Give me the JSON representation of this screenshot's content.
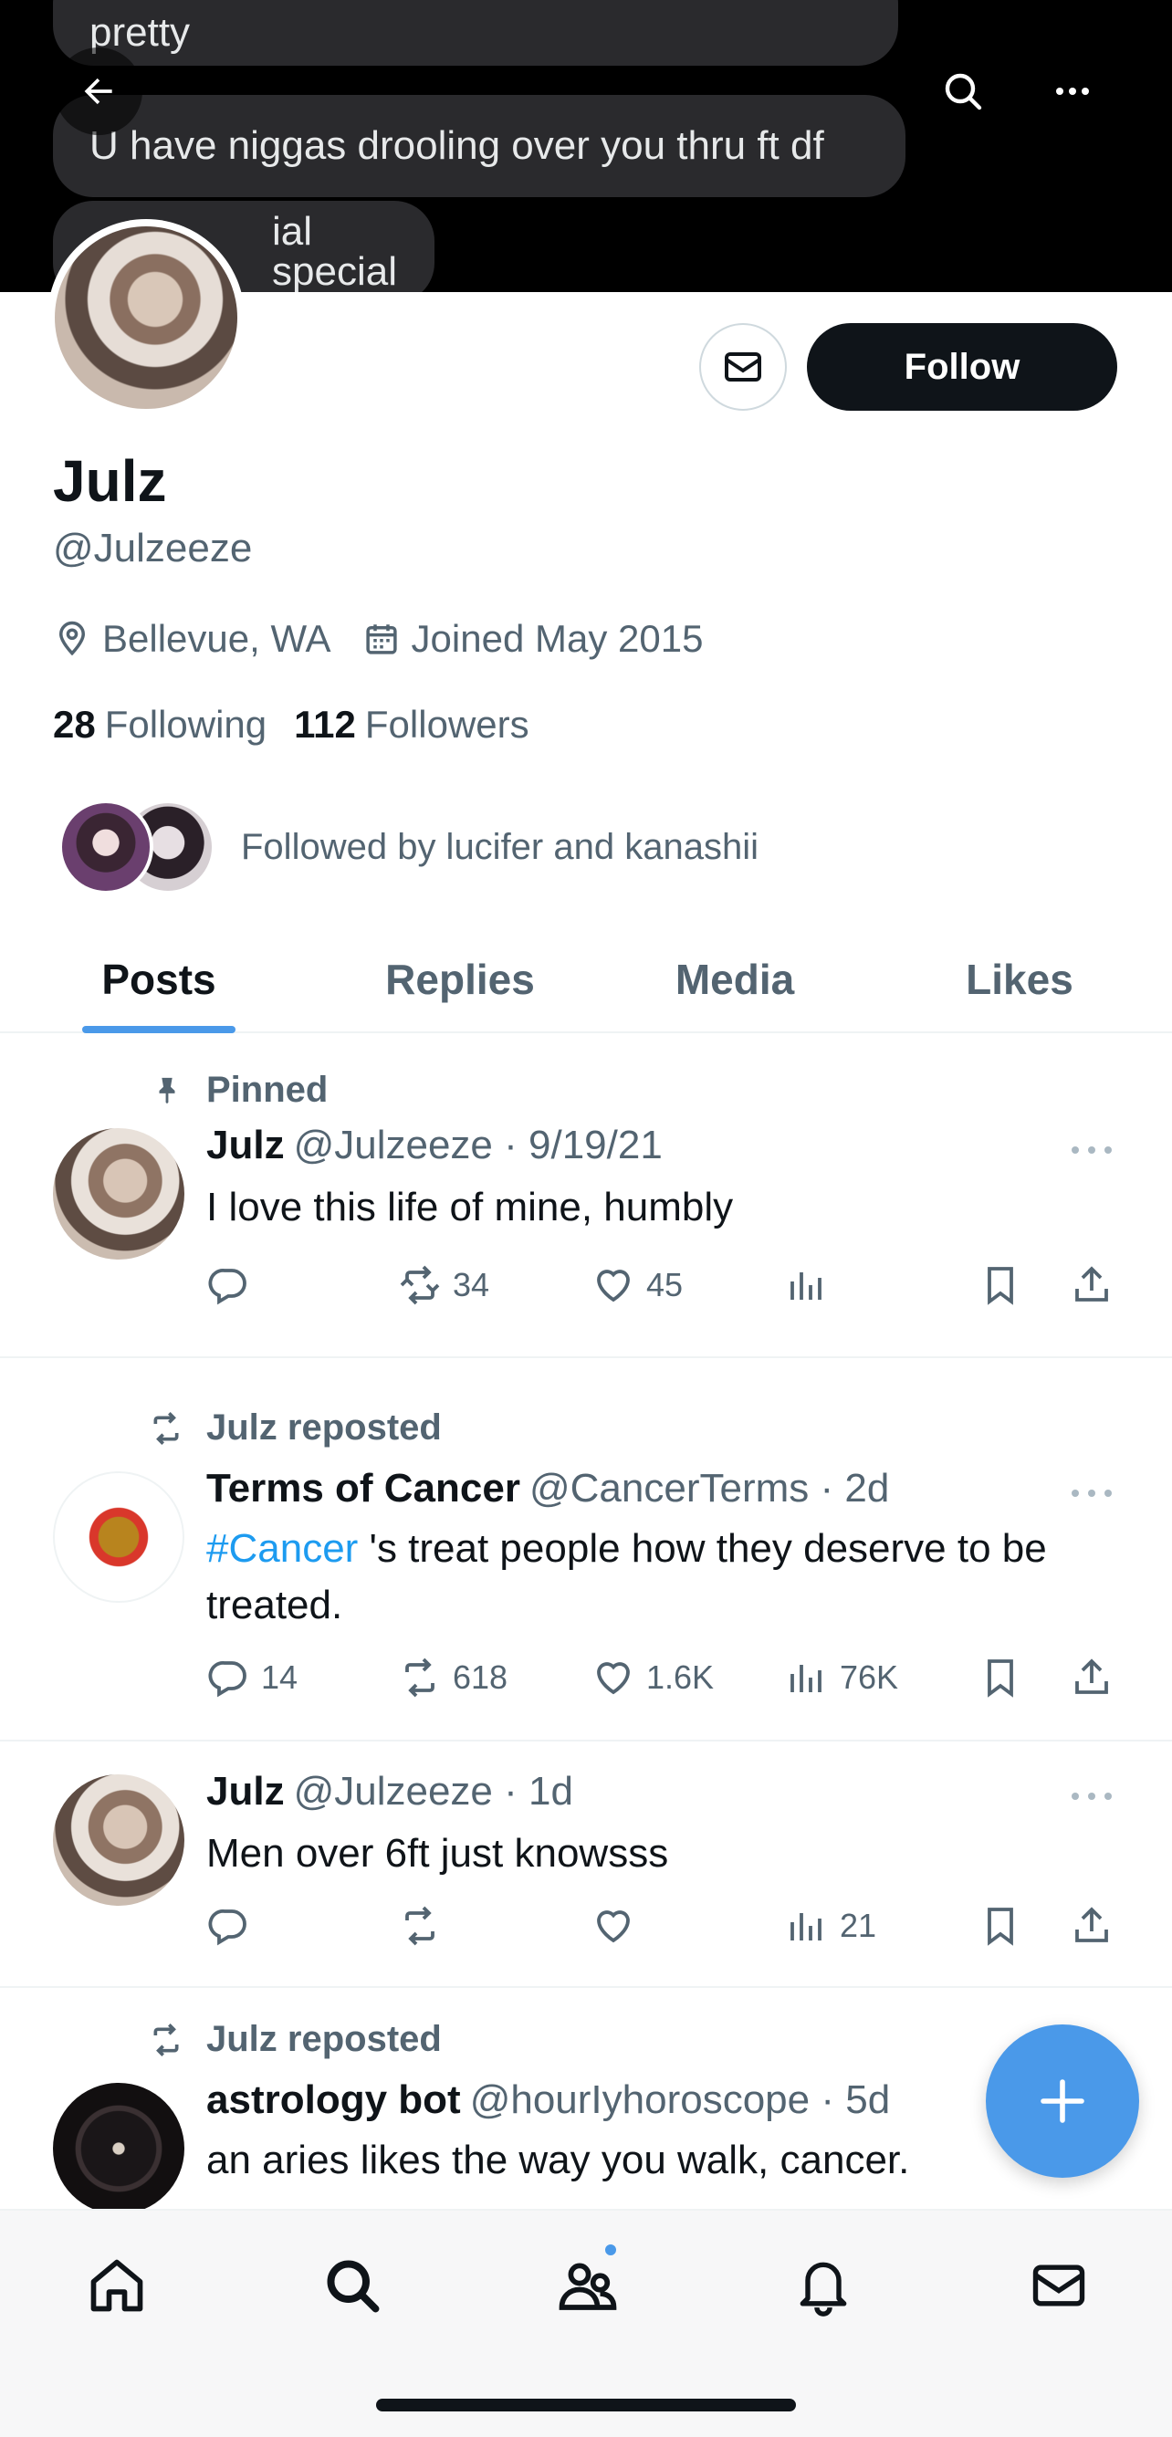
{
  "banner": {
    "bubbles": [
      "pretty",
      "U have niggas drooling over you thru ft df",
      "ial special"
    ]
  },
  "profile": {
    "name": "Julz",
    "handle": "@Julzeeze",
    "location": "Bellevue, WA",
    "joined": "Joined May 2015",
    "following_count": "28",
    "following_label": "Following",
    "followers_count": "112",
    "followers_label": "Followers",
    "followed_by": "Followed by lucifer and kanashii",
    "follow_button": "Follow"
  },
  "tabs": [
    "Posts",
    "Replies",
    "Media",
    "Likes"
  ],
  "posts": [
    {
      "context": "Pinned",
      "name": "Julz",
      "handle": "@Julzeeze · 9/19/21",
      "text": "I love this life of mine, humbly",
      "replies": "",
      "reposts": "34",
      "likes": "45",
      "views": ""
    },
    {
      "context": "Julz reposted",
      "name": "Terms of Cancer",
      "handle": "@CancerTerms · 2d",
      "hashtag": "#Cancer",
      "text": " 's treat people how they deserve to be treated.",
      "replies": "14",
      "reposts": "618",
      "likes": "1.6K",
      "views": "76K"
    },
    {
      "context": "",
      "name": "Julz",
      "handle": "@Julzeeze · 1d",
      "text": "Men over 6ft just knowsss",
      "replies": "",
      "reposts": "",
      "likes": "",
      "views": "21"
    },
    {
      "context": "Julz reposted",
      "name": "astrology bot",
      "handle": "@hourIyhoroscope · 5d",
      "text": "an aries likes the way you walk, cancer."
    }
  ],
  "colors": {
    "accent": "#4a99e9",
    "link": "#1d9bf0",
    "text": "#0f1419",
    "muted": "#536471"
  }
}
